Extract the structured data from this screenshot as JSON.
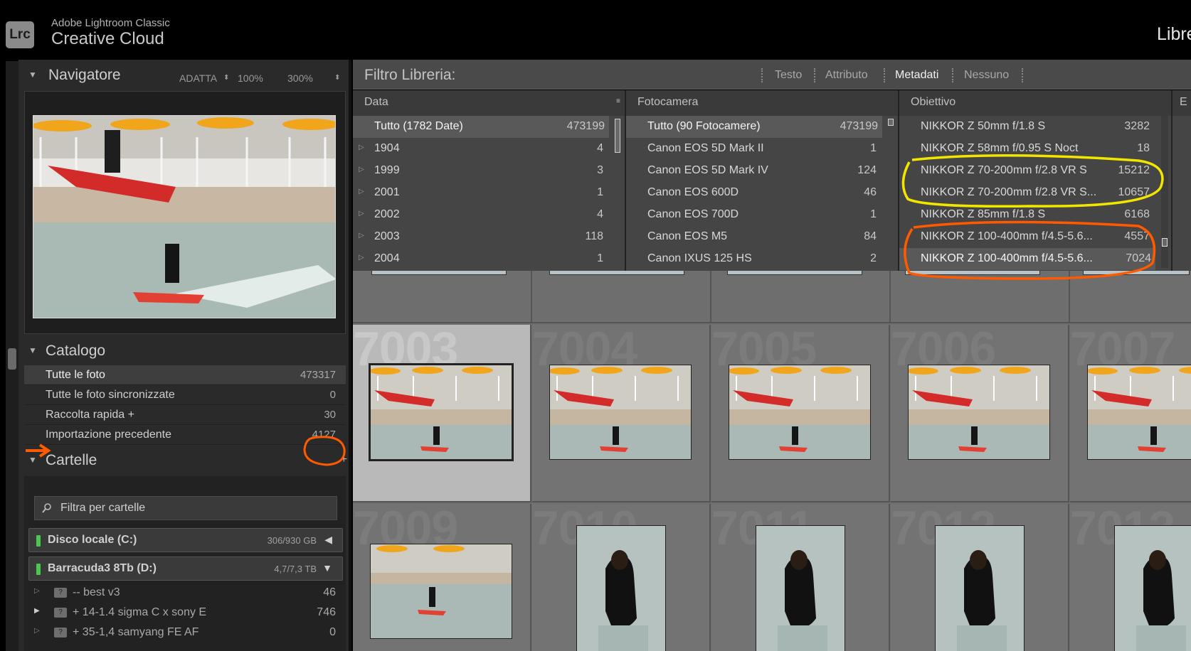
{
  "app": {
    "logo": "Lrc",
    "line1": "Adobe Lightroom Classic",
    "line2": "Creative Cloud",
    "module": "Libreria"
  },
  "navigator": {
    "title": "Navigatore",
    "options": [
      "ADATTA",
      "100%",
      "300%"
    ]
  },
  "catalog": {
    "title": "Catalogo",
    "items": [
      {
        "label": "Tutte le foto",
        "count": "473317",
        "selected": true
      },
      {
        "label": "Tutte le foto sincronizzate",
        "count": "0"
      },
      {
        "label": "Raccolta rapida +",
        "count": "30"
      },
      {
        "label": "Importazione precedente",
        "count": "4127"
      }
    ]
  },
  "folders": {
    "title": "Cartelle",
    "add_icon": "plus-icon",
    "filter_placeholder": "Filtra per cartelle",
    "volumes": [
      {
        "name": "Disco locale (C:)",
        "size": "306/930 GB",
        "indicator": "#49c94c"
      },
      {
        "name": "Barracuda3 8Tb (D:)",
        "size": "4,7/7,3 TB",
        "indicator": "#49c94c"
      }
    ],
    "items": [
      {
        "label": "-- best v3",
        "count": "46"
      },
      {
        "label": "+ 14-1.4 sigma C x sony E",
        "count": "746"
      },
      {
        "label": "+ 35-1,4 samyang FE AF",
        "count": "0"
      }
    ]
  },
  "filter": {
    "title": "Filtro Libreria:",
    "tabs": [
      {
        "label": "Testo"
      },
      {
        "label": "Attributo"
      },
      {
        "label": "Metadati",
        "active": true
      },
      {
        "label": "Nessuno"
      }
    ]
  },
  "columns": [
    {
      "header": "Data",
      "rows": [
        {
          "label": "Tutto (1782 Date)",
          "count": "473199",
          "selected": true
        },
        {
          "label": "1904",
          "count": "4"
        },
        {
          "label": "1999",
          "count": "3"
        },
        {
          "label": "2001",
          "count": "1"
        },
        {
          "label": "2002",
          "count": "4"
        },
        {
          "label": "2003",
          "count": "118"
        },
        {
          "label": "2004",
          "count": "1"
        }
      ]
    },
    {
      "header": "Fotocamera",
      "rows": [
        {
          "label": "Tutto (90 Fotocamere)",
          "count": "473199",
          "selected": true
        },
        {
          "label": "Canon EOS 5D Mark II",
          "count": "1"
        },
        {
          "label": "Canon EOS 5D Mark IV",
          "count": "124"
        },
        {
          "label": "Canon EOS 600D",
          "count": "46"
        },
        {
          "label": "Canon EOS 700D",
          "count": "1"
        },
        {
          "label": "Canon EOS M5",
          "count": "84"
        },
        {
          "label": "Canon IXUS 125 HS",
          "count": "2"
        }
      ]
    },
    {
      "header": "Obiettivo",
      "rows": [
        {
          "label": "NIKKOR Z 50mm f/1.8 S",
          "count": "3282"
        },
        {
          "label": "NIKKOR Z 58mm f/0.95 S Noct",
          "count": "18"
        },
        {
          "label": "NIKKOR Z 70-200mm f/2.8 VR S",
          "count": "15212"
        },
        {
          "label": "NIKKOR Z 70-200mm f/2.8 VR S...",
          "count": "10657"
        },
        {
          "label": "NIKKOR Z 85mm f/1.8 S",
          "count": "6168"
        },
        {
          "label": "NIKKOR Z 100-400mm f/4.5-5.6...",
          "count": "4557"
        },
        {
          "label": "NIKKOR Z 100-400mm f/4.5-5.6...",
          "count": "7024",
          "selected": true
        }
      ]
    },
    {
      "header": "E",
      "rows": []
    }
  ],
  "grid": {
    "cells": [
      {
        "num": "7003",
        "selected": true
      },
      {
        "num": "7004"
      },
      {
        "num": "7005"
      },
      {
        "num": "7006"
      },
      {
        "num": "7007"
      },
      {
        "num": "7009"
      },
      {
        "num": "7010"
      },
      {
        "num": "7011"
      },
      {
        "num": "7012"
      },
      {
        "num": "7013"
      }
    ]
  },
  "annotations": {
    "yellow": "#f2e600",
    "orange": "#ff5a00"
  }
}
